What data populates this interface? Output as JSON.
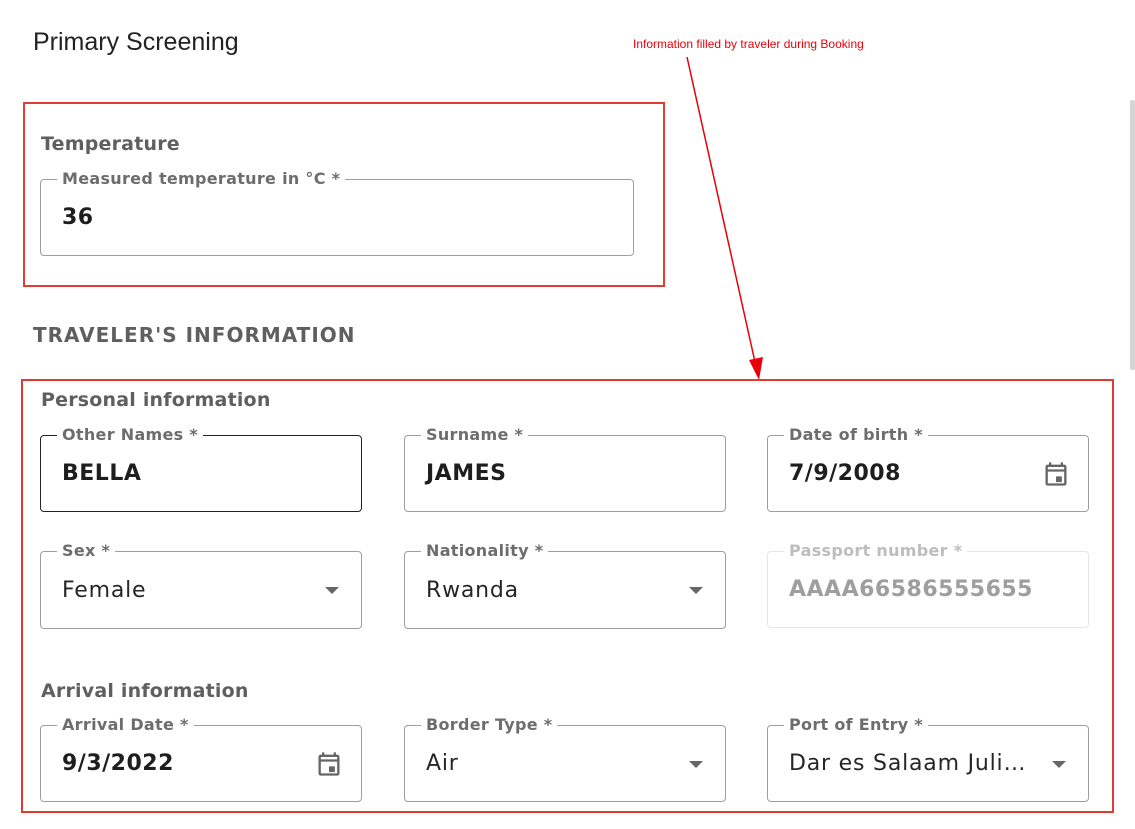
{
  "page": {
    "title": "Primary Screening"
  },
  "annotation": {
    "text": "Information filled by traveler during Booking",
    "color": "#e8000b"
  },
  "temperature": {
    "section_label": "Temperature",
    "field_label": "Measured temperature in °C *",
    "value": "36"
  },
  "traveler": {
    "heading": "TRAVELER'S INFORMATION",
    "personal": {
      "section_label": "Personal information",
      "other_names": {
        "label": "Other Names *",
        "value": "BELLA"
      },
      "surname": {
        "label": "Surname *",
        "value": "JAMES"
      },
      "date_of_birth": {
        "label": "Date of birth *",
        "value": "7/9/2008",
        "icon": "calendar-icon"
      },
      "sex": {
        "label": "Sex *",
        "value": "Female",
        "icon": "dropdown-arrow-icon"
      },
      "nationality": {
        "label": "Nationality *",
        "value": "Rwanda",
        "icon": "dropdown-arrow-icon"
      },
      "passport": {
        "label": "Passport number *",
        "value": "AAAA66586555655"
      }
    },
    "arrival": {
      "section_label": "Arrival information",
      "arrival_date": {
        "label": "Arrival Date *",
        "value": "9/3/2022",
        "icon": "calendar-icon"
      },
      "border_type": {
        "label": "Border Type *",
        "value": "Air",
        "icon": "dropdown-arrow-icon"
      },
      "port_of_entry": {
        "label": "Port of Entry *",
        "value": "Dar es Salaam Julius Nyerere",
        "icon": "dropdown-arrow-icon"
      }
    }
  },
  "colors": {
    "highlight_border": "#e53935",
    "label_gray": "#6d6d6d"
  }
}
